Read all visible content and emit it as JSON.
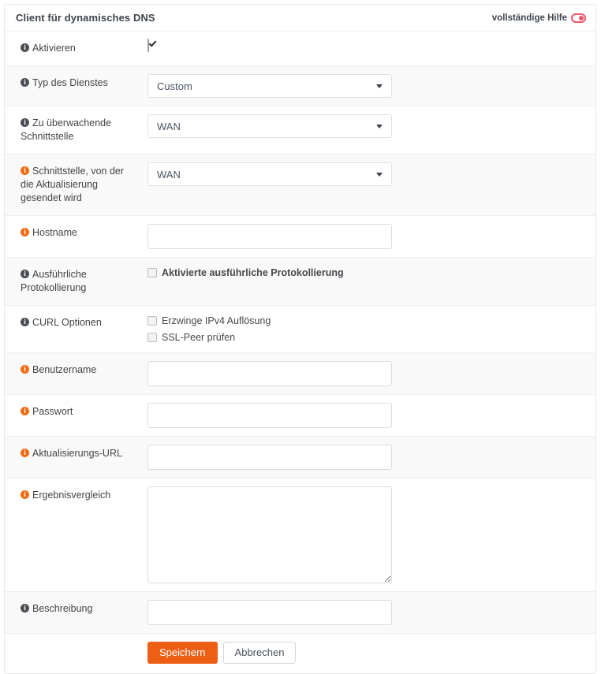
{
  "header": {
    "title": "Client für dynamisches DNS",
    "help_label": "vollständige Hilfe",
    "help_icon": "toggle-switch-icon",
    "help_icon_color": "#f2556a"
  },
  "theme": {
    "required_icon_color": "#ef6c16",
    "optional_icon_color": "#4a4f55",
    "primary_button_color": "#ee5f16",
    "row_alt_background": "#f9f9f9",
    "border_color": "#eeeeee"
  },
  "rows": {
    "enable": {
      "label": "Aktivieren",
      "required": false,
      "checked": true
    },
    "service_type": {
      "label": "Typ des Dienstes",
      "required": false,
      "value": "Custom"
    },
    "monitored_interface": {
      "label": "Zu überwachende Schnittstelle",
      "required": false,
      "value": "WAN"
    },
    "update_source_interface": {
      "label": "Schnittstelle, von der die Aktualisierung gesendet wird",
      "required": true,
      "value": "WAN"
    },
    "hostname": {
      "label": "Hostname",
      "required": true,
      "value": "",
      "placeholder": ""
    },
    "verbose_logging": {
      "label": "Ausführliche Protokollierung",
      "required": false,
      "checkbox_label": "Aktivierte ausführliche Protokollierung",
      "checked": false
    },
    "curl_options": {
      "label": "CURL Optionen",
      "required": false,
      "options": [
        {
          "label": "Erzwinge IPv4 Auflösung",
          "checked": false
        },
        {
          "label": "SSL-Peer prüfen",
          "checked": false
        }
      ]
    },
    "username": {
      "label": "Benutzername",
      "required": true,
      "value": "",
      "placeholder": ""
    },
    "password": {
      "label": "Passwort",
      "required": true,
      "value": "",
      "placeholder": ""
    },
    "update_url": {
      "label": "Aktualisierungs-URL",
      "required": true,
      "value": "",
      "placeholder": ""
    },
    "result_match": {
      "label": "Ergebnisvergleich",
      "required": true,
      "value": "",
      "placeholder": ""
    },
    "description": {
      "label": "Beschreibung",
      "required": false,
      "value": "",
      "placeholder": ""
    }
  },
  "actions": {
    "save_label": "Speichern",
    "cancel_label": "Abbrechen"
  }
}
